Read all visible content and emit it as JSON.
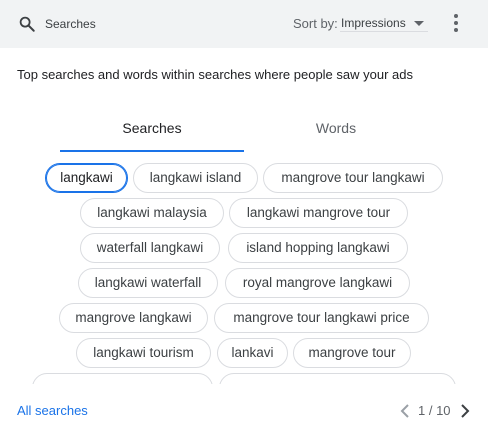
{
  "header": {
    "title": "Searches",
    "sort_label": "Sort by:",
    "sort_value": "Impressions",
    "icons": {
      "search": "search-icon",
      "more": "more-vert-icon",
      "caret": "caret-down-icon"
    }
  },
  "description": "Top searches and words within searches where people saw your ads",
  "tabs": [
    {
      "label": "Searches",
      "active": true
    },
    {
      "label": "Words",
      "active": false
    }
  ],
  "chips": [
    {
      "label": "langkawi",
      "selected": true
    },
    {
      "label": "langkawi island",
      "selected": false
    },
    {
      "label": "mangrove tour langkawi",
      "selected": false
    },
    {
      "label": "langkawi malaysia",
      "selected": false
    },
    {
      "label": "langkawi mangrove tour",
      "selected": false
    },
    {
      "label": "waterfall langkawi",
      "selected": false
    },
    {
      "label": "island hopping langkawi",
      "selected": false
    },
    {
      "label": "langkawi waterfall",
      "selected": false
    },
    {
      "label": "royal mangrove langkawi",
      "selected": false
    },
    {
      "label": "mangrove langkawi",
      "selected": false
    },
    {
      "label": "mangrove tour langkawi price",
      "selected": false
    },
    {
      "label": "langkawi tourism",
      "selected": false
    },
    {
      "label": "lankavi",
      "selected": false
    },
    {
      "label": "mangrove tour",
      "selected": false
    }
  ],
  "footer": {
    "link": "All searches",
    "page": "1 / 10",
    "icons": {
      "prev": "chevron-left-icon",
      "next": "chevron-right-icon"
    }
  },
  "colors": {
    "accent": "#1a73e8",
    "header_bg": "#f1f3f4",
    "chip_border": "#dadce0",
    "text": "#202124",
    "muted": "#5f6368"
  }
}
